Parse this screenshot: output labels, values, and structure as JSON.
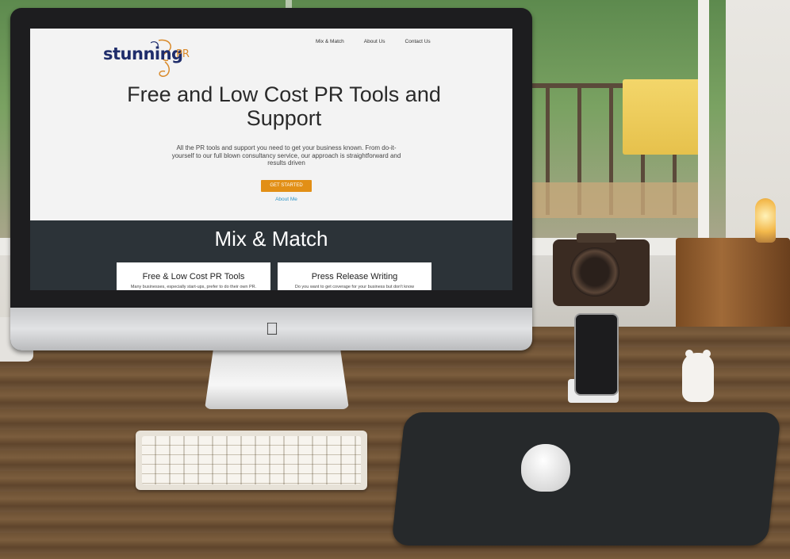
{
  "site": {
    "logo_text": "stunning",
    "logo_suffix": "PR",
    "nav": [
      "Mix & Match",
      "About Us",
      "Contact Us"
    ],
    "hero": {
      "title": "Free and Low Cost PR Tools and Support",
      "subtitle": "All the PR tools and support you need to get your business known. From do-it-yourself to our full blown consultancy service, our approach is straightforward and results driven",
      "cta_label": "GET STARTED",
      "secondary_link": "About Me"
    },
    "mix": {
      "title": "Mix & Match",
      "cards": [
        {
          "title": "Free & Low Cost PR Tools",
          "text": "Many businesses, especially start-ups, prefer to do their own PR."
        },
        {
          "title": "Press Release Writing",
          "text": "Do you want to get coverage for your business but don't know"
        }
      ]
    }
  },
  "colors": {
    "accent_orange": "#e28f16",
    "logo_navy": "#1f2d6b",
    "dark_band": "#2c3338",
    "link_blue": "#2e94c7"
  },
  "icons": {
    "apple": "apple-logo-icon"
  }
}
